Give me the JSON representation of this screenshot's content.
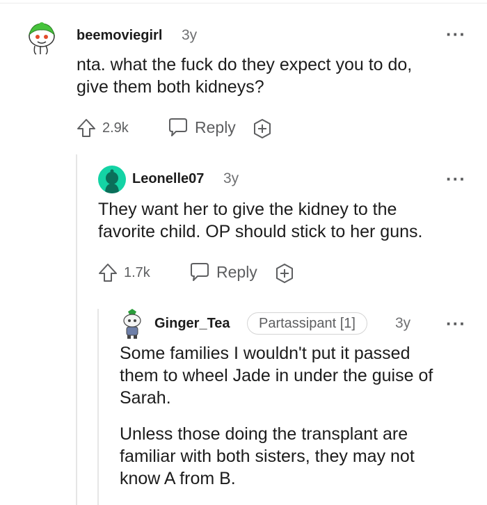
{
  "comments": [
    {
      "username": "beemoviegirl",
      "age": "3y",
      "text_lines": [
        "nta. what the fuck do they expect you to do,",
        "give them both kidneys?"
      ],
      "upvotes": "2.9k",
      "reply_label": "Reply",
      "avatar_icon": "snoo-bee-avatar-icon"
    },
    {
      "username": "Leonelle07",
      "age": "3y",
      "text_lines": [
        "They want her to give the kidney to the",
        "favorite child. OP should stick to her guns."
      ],
      "upvotes": "1.7k",
      "reply_label": "Reply",
      "avatar_icon": "snoo-teal-avatar-icon"
    },
    {
      "username": "Ginger_Tea",
      "flair": "Partassipant [1]",
      "age": "3y",
      "paragraphs": [
        [
          "Some families I wouldn't put it passed",
          "them to wheel Jade in under the guise of",
          "Sarah."
        ],
        [
          "Unless those doing the transplant are",
          "familiar with both sisters, they may not",
          "know A from B."
        ]
      ],
      "avatar_icon": "snoo-ginger-avatar-icon"
    }
  ],
  "colors": {
    "text": "#1c1c1c",
    "muted": "#6f7072",
    "thread_line": "#e6e6e6",
    "avatar_teal": "#14d3a5"
  },
  "icons": {
    "upvote": "upvote-arrow-icon",
    "reply": "speech-bubble-icon",
    "award": "award-plus-icon",
    "more": "more-options-icon"
  }
}
